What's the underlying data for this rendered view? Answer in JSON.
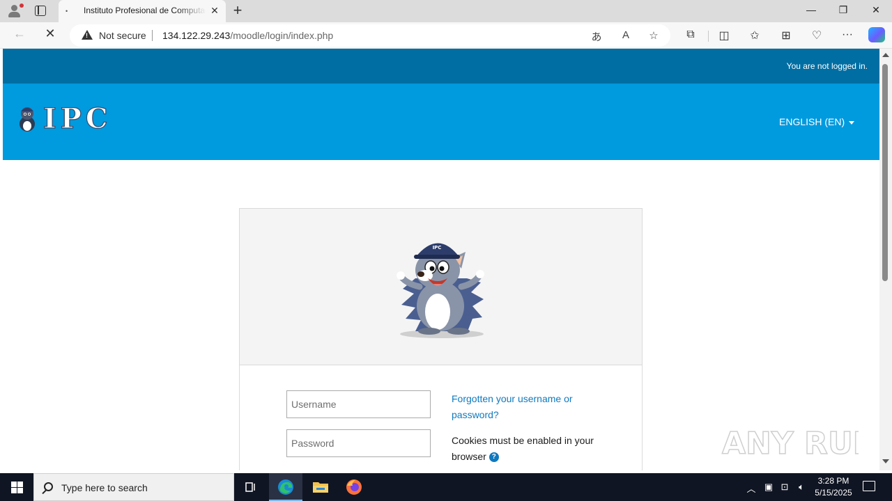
{
  "browser": {
    "tab_title": "Instituto Profesional de Computación",
    "tab_favicon": "•",
    "security_label": "Not secure",
    "url_host": "134.122.29.243",
    "url_path": "/moodle/login/index.php"
  },
  "page": {
    "login_status": "You are not logged in.",
    "brand": "IPC",
    "language": "ENGLISH (EN)",
    "username_placeholder": "Username",
    "password_placeholder": "Password",
    "forgot_link": "Forgotten your username or password?",
    "cookies_notice": "Cookies must be enabled in your browser",
    "mascot_cap_text": "IPC"
  },
  "taskbar": {
    "search_placeholder": "Type here to search",
    "time": "3:28 PM",
    "date": "5/15/2025"
  },
  "watermark": "ANY RUN",
  "colors": {
    "topbar": "#006ea3",
    "header": "#009adf",
    "link": "#0f79bf",
    "taskbar": "#101523"
  }
}
